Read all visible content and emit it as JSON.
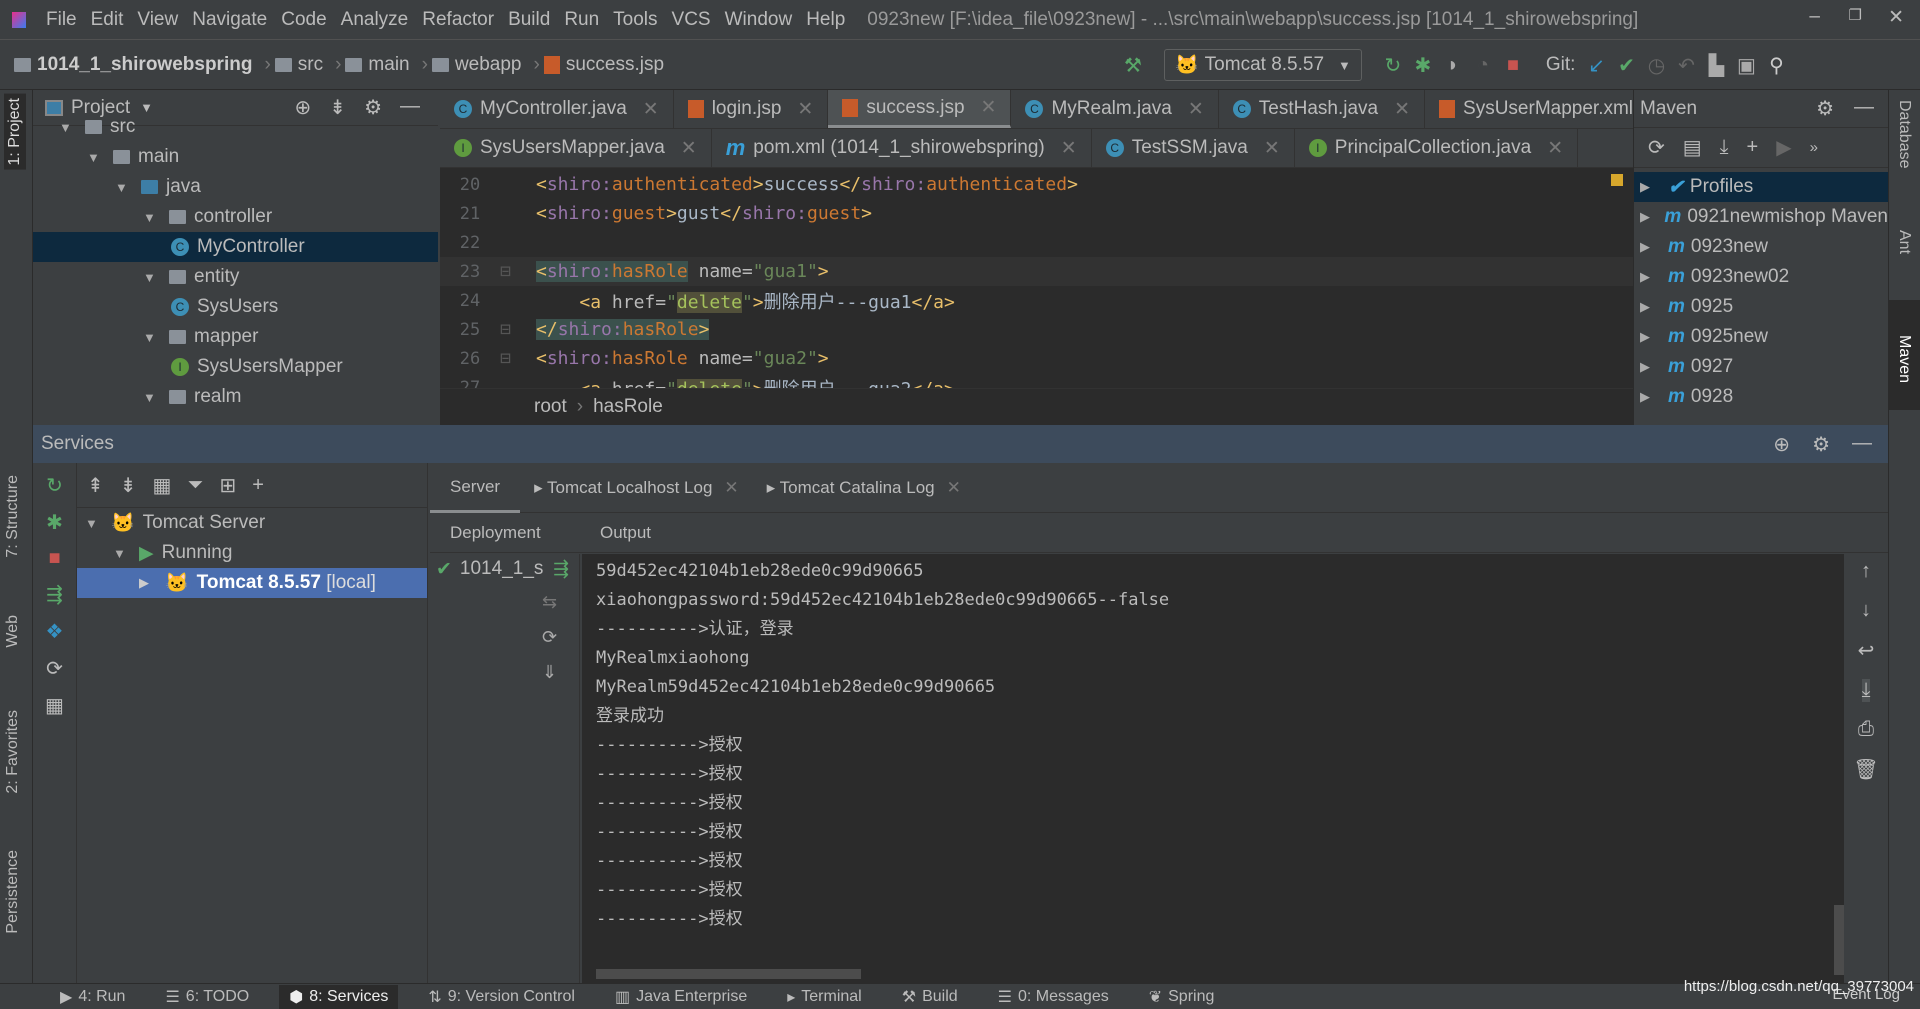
{
  "menu": {
    "items": [
      "File",
      "Edit",
      "View",
      "Navigate",
      "Code",
      "Analyze",
      "Refactor",
      "Build",
      "Run",
      "Tools",
      "VCS",
      "Window",
      "Help"
    ],
    "title": "0923new [F:\\idea_file\\0923new] - ...\\src\\main\\webapp\\success.jsp [1014_1_shirowebspring]"
  },
  "nav": {
    "breadcrumb": [
      "1014_1_shirowebspring",
      "src",
      "main",
      "webapp",
      "success.jsp"
    ],
    "run_config": "Tomcat 8.5.57",
    "git_label": "Git:"
  },
  "project": {
    "title": "Project",
    "tree": [
      {
        "label": "src",
        "depth": 1
      },
      {
        "label": "main",
        "depth": 2,
        "type": "folder"
      },
      {
        "label": "java",
        "depth": 3,
        "type": "folder"
      },
      {
        "label": "controller",
        "depth": 4,
        "type": "folder"
      },
      {
        "label": "MyController",
        "depth": 5,
        "type": "class",
        "selected": true
      },
      {
        "label": "entity",
        "depth": 4,
        "type": "folder"
      },
      {
        "label": "SysUsers",
        "depth": 5,
        "type": "class"
      },
      {
        "label": "mapper",
        "depth": 4,
        "type": "folder"
      },
      {
        "label": "SysUsersMapper",
        "depth": 5,
        "type": "interface"
      },
      {
        "label": "realm",
        "depth": 4,
        "type": "folder"
      }
    ]
  },
  "editor": {
    "tabs_row1": [
      "MyController.java",
      "login.jsp",
      "success.jsp",
      "MyRealm.java",
      "TestHash.java",
      "SysUserMapper.xml"
    ],
    "active_tab": "success.jsp",
    "tabs_row2": [
      "SysUsersMapper.java",
      "pom.xml (1014_1_shirowebspring)",
      "TestSSM.java",
      "PrincipalCollection.java"
    ],
    "lines": [
      {
        "n": "20",
        "html": "<span class='tg'>&lt;</span><span class='ns'>shiro:</span><span class='tn'>authenticated</span><span class='tg'>&gt;</span><span class='tx'>success</span><span class='tg'>&lt;/</span><span class='ns'>shiro:</span><span class='tn'>authenticated</span><span class='tg'>&gt;</span>"
      },
      {
        "n": "21",
        "html": "<span class='tg'>&lt;</span><span class='ns'>shiro:</span><span class='tn'>guest</span><span class='tg'>&gt;</span><span class='tx'>gust</span><span class='tg'>&lt;/</span><span class='ns'>shiro:</span><span class='tn'>guest</span><span class='tg'>&gt;</span>"
      },
      {
        "n": "22",
        "html": ""
      },
      {
        "n": "23",
        "html": "<span style='background:#3b514d'><span class='tg'>&lt;</span><span class='ns'>shiro:</span><span class='tn'>hasRole</span></span> <span class='at'>name=</span><span class='av'>\"gua1\"</span><span class='tg'>&gt;</span>"
      },
      {
        "n": "24",
        "html": "    <span class='tg'>&lt;a</span> <span class='at'>href=</span><span class='av'>\"<span style='background:#52503a;color:#a5c25c'>delete</span>\"</span><span class='tg'>&gt;</span><span class='tx'>删除用户---gua1</span><span class='tg'>&lt;/a&gt;</span>"
      },
      {
        "n": "25",
        "html": "<span style='background:#3b514d'><span class='tg'>&lt;/</span><span class='ns'>shiro:</span><span class='tn'>hasRole</span><span class='tg'>&gt;</span></span>"
      },
      {
        "n": "26",
        "html": "<span class='tg'>&lt;</span><span class='ns'>shiro:</span><span class='tn'>hasRole</span> <span class='at'>name=</span><span class='av'>\"gua2\"</span><span class='tg'>&gt;</span>"
      },
      {
        "n": "27",
        "html": "    <span class='tg'>&lt;a</span> <span class='at'>href=</span><span class='av'>\"<span style='background:#52503a;color:#a5c25c'>delete</span>\"</span><span class='tg'>&gt;</span><span class='tx'>删除用户---gua2</span><span class='tg'>&lt;/a&gt;</span>"
      }
    ],
    "breadcrumb": [
      "root",
      "hasRole"
    ]
  },
  "maven": {
    "title": "Maven",
    "items": [
      "Profiles",
      "0921newmishop Maven",
      "0923new",
      "0923new02",
      "0925",
      "0925new",
      "0927",
      "0928"
    ]
  },
  "right_strip": [
    "Database",
    "Ant",
    "Maven"
  ],
  "left_strip": [
    "1: Project",
    "7: Structure",
    "Web",
    "2: Favorites",
    "Persistence"
  ],
  "services": {
    "title": "Services",
    "tree": [
      {
        "label": "Tomcat Server"
      },
      {
        "label": "Running"
      },
      {
        "label": "Tomcat 8.5.57",
        "suffix": "[local]"
      }
    ],
    "tabs": [
      "Server",
      "Tomcat Localhost Log",
      "Tomcat Catalina Log"
    ],
    "subtabs": [
      "Deployment",
      "Output"
    ],
    "deployment": "1014_1_s",
    "output": [
      "59d452ec42104b1eb28ede0c99d90665",
      "xiaohongpassword:59d452ec42104b1eb28ede0c99d90665--false",
      "---------->认证，登录",
      "MyRealmxiaohong",
      "MyRealm59d452ec42104b1eb28ede0c99d90665",
      "登录成功",
      "---------->授权",
      "---------->授权",
      "---------->授权",
      "---------->授权",
      "---------->授权",
      "---------->授权",
      "---------->授权"
    ]
  },
  "status": {
    "items": [
      "4: Run",
      "6: TODO",
      "8: Services",
      "9: Version Control",
      "Java Enterprise",
      "Terminal",
      "Build",
      "0: Messages",
      "Spring"
    ],
    "active": "8: Services",
    "event_log": "Event Log",
    "watermark": "https://blog.csdn.net/qq_39773004"
  }
}
